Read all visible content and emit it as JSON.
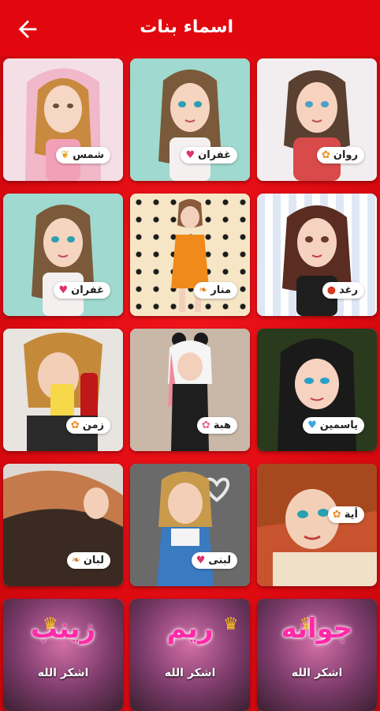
{
  "header": {
    "title": "اسماء بنات",
    "back_icon": "arrow-back-icon"
  },
  "colors": {
    "primary": "#e2070f",
    "background": "#dc0a10"
  },
  "cards": [
    {
      "name": "روان",
      "icon": "flower-icon",
      "ico_char": "✿",
      "ico_color": "#f08a1e"
    },
    {
      "name": "غفران",
      "icon": "heart-icon",
      "ico_char": "♥",
      "ico_color": "#e0306a"
    },
    {
      "name": "شمس",
      "icon": "bow-icon",
      "ico_char": "❦",
      "ico_color": "#e6a21a"
    },
    {
      "name": "رغد",
      "icon": "strawberry-icon",
      "ico_char": "●",
      "ico_color": "#d83a1f"
    },
    {
      "name": "منار",
      "icon": "leaf-icon",
      "ico_char": "❧",
      "ico_color": "#e0781a"
    },
    {
      "name": "غفران",
      "icon": "heart-icon",
      "ico_char": "♥",
      "ico_color": "#e0306a"
    },
    {
      "name": "ياسمين",
      "icon": "heart-icon",
      "ico_char": "♥",
      "ico_color": "#3aa7e0"
    },
    {
      "name": "هبة",
      "icon": "flower-icon",
      "ico_char": "✿",
      "ico_color": "#e8609a"
    },
    {
      "name": "زمن",
      "icon": "flower-icon",
      "ico_char": "✿",
      "ico_color": "#f08a1e"
    },
    {
      "name": "أية",
      "icon": "flower-icon",
      "ico_char": "✿",
      "ico_color": "#f08a1e"
    },
    {
      "name": "لبنى",
      "icon": "heart-icon",
      "ico_char": "♥",
      "ico_color": "#e0306a"
    },
    {
      "name": "لبان",
      "icon": "leaf-icon",
      "ico_char": "❧",
      "ico_color": "#e0781a"
    }
  ],
  "bottom_cards": [
    {
      "name": "جوانه",
      "sub": "اشكر الله"
    },
    {
      "name": "ريم",
      "sub": "اشكر الله"
    },
    {
      "name": "زينب",
      "sub": "اشكر الله"
    }
  ]
}
